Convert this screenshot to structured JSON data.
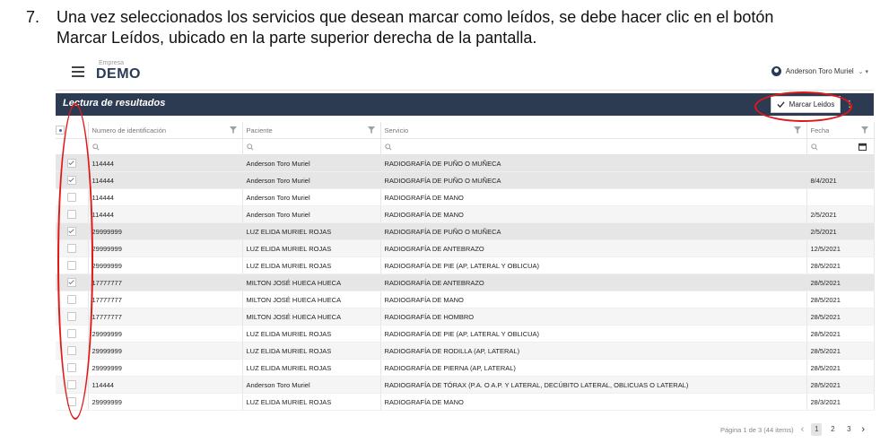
{
  "instruction": {
    "number": "7.",
    "text": "Una vez seleccionados los servicios que desean marcar como leídos, se debe hacer clic en el botón Marcar Leídos, ubicado en la parte superior derecha de la pantalla."
  },
  "brand": {
    "small": "Empresa",
    "big": "DEMO"
  },
  "user": {
    "name": "Anderson Toro Muriel"
  },
  "header": {
    "title": "Lectura de resultados",
    "mark_button": "Marcar Leidos"
  },
  "columns": [
    "Numero de identificación",
    "Paciente",
    "Servicio",
    "Fecha"
  ],
  "rows": [
    {
      "id": "114444",
      "patient": "Anderson Toro Muriel",
      "service": "RADIOGRAFÍA DE PUÑO O MUÑECA",
      "date": "",
      "checked": true
    },
    {
      "id": "114444",
      "patient": "Anderson Toro Muriel",
      "service": "RADIOGRAFÍA DE PUÑO O MUÑECA",
      "date": "8/4/2021",
      "checked": true
    },
    {
      "id": "114444",
      "patient": "Anderson Toro Muriel",
      "service": "RADIOGRAFÍA DE MANO",
      "date": "",
      "checked": false
    },
    {
      "id": "114444",
      "patient": "Anderson Toro Muriel",
      "service": "RADIOGRAFÍA DE MANO",
      "date": "2/5/2021",
      "checked": false
    },
    {
      "id": "29999999",
      "patient": "LUZ ELIDA MURIEL ROJAS",
      "service": "RADIOGRAFÍA DE PUÑO O MUÑECA",
      "date": "2/5/2021",
      "checked": true
    },
    {
      "id": "29999999",
      "patient": "LUZ ELIDA MURIEL ROJAS",
      "service": "RADIOGRAFÍA DE ANTEBRAZO",
      "date": "12/5/2021",
      "checked": false
    },
    {
      "id": "29999999",
      "patient": "LUZ ELIDA MURIEL ROJAS",
      "service": "RADIOGRAFÍA DE PIE (AP, LATERAL Y OBLICUA)",
      "date": "28/5/2021",
      "checked": false
    },
    {
      "id": "17777777",
      "patient": "MILTON JOSÉ HUECA HUECA",
      "service": "RADIOGRAFÍA DE ANTEBRAZO",
      "date": "28/5/2021",
      "checked": true
    },
    {
      "id": "17777777",
      "patient": "MILTON JOSÉ HUECA HUECA",
      "service": "RADIOGRAFÍA DE MANO",
      "date": "28/5/2021",
      "checked": false
    },
    {
      "id": "17777777",
      "patient": "MILTON JOSÉ HUECA HUECA",
      "service": "RADIOGRAFÍA DE HOMBRO",
      "date": "28/5/2021",
      "checked": false
    },
    {
      "id": "29999999",
      "patient": "LUZ ELIDA MURIEL ROJAS",
      "service": "RADIOGRAFÍA DE PIE (AP, LATERAL Y OBLICUA)",
      "date": "28/5/2021",
      "checked": false
    },
    {
      "id": "29999999",
      "patient": "LUZ ELIDA MURIEL ROJAS",
      "service": "RADIOGRAFÍA DE RODILLA (AP, LATERAL)",
      "date": "28/5/2021",
      "checked": false
    },
    {
      "id": "29999999",
      "patient": "LUZ ELIDA MURIEL ROJAS",
      "service": "RADIOGRAFÍA DE PIERNA (AP, LATERAL)",
      "date": "28/5/2021",
      "checked": false
    },
    {
      "id": "114444",
      "patient": "Anderson Toro Muriel",
      "service": "RADIOGRAFÍA DE TÓRAX (P.A. O A.P. Y LATERAL, DECÚBITO LATERAL, OBLICUAS O LATERAL)",
      "date": "28/5/2021",
      "checked": false
    },
    {
      "id": "29999999",
      "patient": "LUZ ELIDA MURIEL ROJAS",
      "service": "RADIOGRAFÍA DE MANO",
      "date": "28/3/2021",
      "checked": false
    }
  ],
  "pager": {
    "info": "Página 1 de 3 (44 items)",
    "pages": [
      "1",
      "2",
      "3"
    ],
    "current": "1"
  },
  "colors": {
    "header_bar": "#2c3b51",
    "annotation": "#e01818"
  }
}
